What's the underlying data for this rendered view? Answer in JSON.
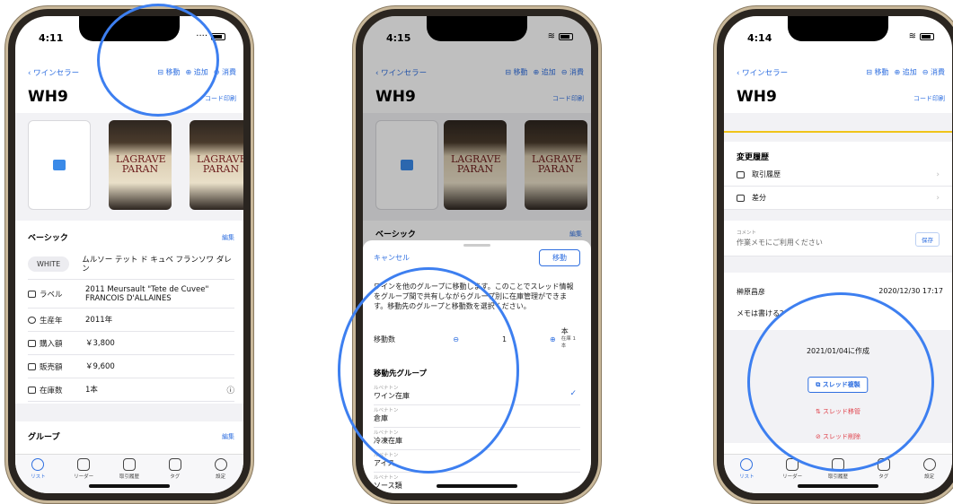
{
  "phone1": {
    "time": "4:11",
    "back": "ワインセラー",
    "actions": [
      "移動",
      "追加",
      "消費"
    ],
    "title": "WH9",
    "print": "コード印刷",
    "basic_header": "ベーシック",
    "edit": "編集",
    "white_badge": "WHITE",
    "wine_name": "ムルソー テット ド キュベ フランソワ ダレン",
    "rows": [
      {
        "key": "ラベル",
        "value": "2011 Meursault \"Tete de Cuvee\" FRANCOIS D'ALLAINES"
      },
      {
        "key": "生産年",
        "value": "2011年"
      },
      {
        "key": "購入額",
        "value": "￥3,800"
      },
      {
        "key": "販売額",
        "value": "￥9,600"
      },
      {
        "key": "在庫数",
        "value": "1本"
      }
    ],
    "group_header": "グループ",
    "group_edit": "編集"
  },
  "tabs": [
    "リスト",
    "リーダー",
    "取引履歴",
    "タグ",
    "設定"
  ],
  "phone2": {
    "time": "4:15",
    "back": "ワインセラー",
    "actions": [
      "移動",
      "追加",
      "消費"
    ],
    "title": "WH9",
    "print": "コード印刷",
    "basic_header": "ベーシック",
    "edit": "編集",
    "cancel": "キャンセル",
    "move_btn": "移動",
    "description": "ワインを他のグループに移動します。このことでスレッド情報をグループ間で共有しながらグループ別に在庫管理ができます。移動先のグループと移動数を選択ください。",
    "qty_label": "移動数",
    "qty_value": "1",
    "stock_unit": "本",
    "stock_note": "在庫 1本",
    "dest_header": "移動先グループ",
    "dest_sub": "ルベナトン",
    "destinations": [
      "ワイン在庫",
      "倉庫",
      "冷凍在庫",
      "アイス",
      "ソース類"
    ]
  },
  "phone3": {
    "time": "4:14",
    "back": "ワインセラー",
    "actions": [
      "移動",
      "追加",
      "消費"
    ],
    "title": "WH9",
    "print": "コード印刷",
    "history_header": "変更履歴",
    "history_rows": [
      "取引履歴",
      "差分"
    ],
    "comment_label": "コメント",
    "comment_placeholder": "作業メモにご利用ください",
    "save": "保存",
    "author": "榊原昌彦",
    "date": "2020/12/30 17:17",
    "memo": "メモは書ける？",
    "created": "2021/01/04に作成",
    "copy_thread": "スレッド複製",
    "move_thread": "スレッド移管",
    "delete_thread": "スレッド削除"
  },
  "colors": {
    "accent": "#2f6fe0",
    "highlight": "#3d7ff0",
    "danger": "#e0424b"
  }
}
